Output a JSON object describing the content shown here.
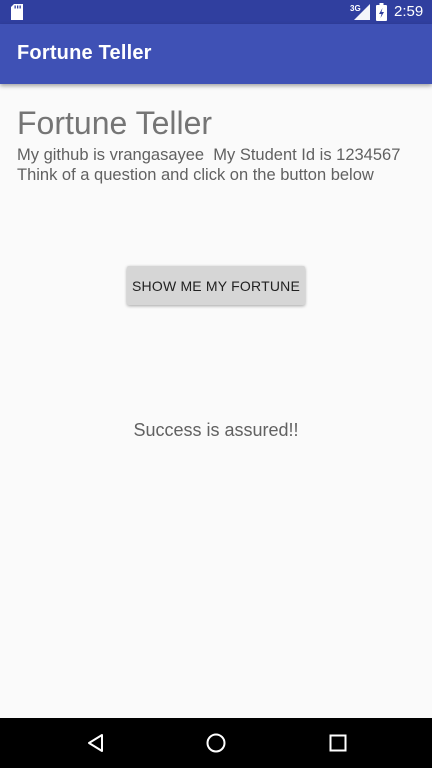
{
  "status_bar": {
    "network_label": "3G",
    "time": "2:59",
    "icons": [
      "sd-card-icon",
      "signal-icon",
      "battery-icon"
    ]
  },
  "app_bar": {
    "title": "Fortune Teller"
  },
  "main": {
    "heading": "Fortune Teller",
    "info_line_1": "My github is vrangasayee  My Student Id is 1234567",
    "info_line_2": "Think of a question and click on the button below",
    "button_label": "SHOW ME MY FORTUNE",
    "fortune": "Success is assured!!"
  },
  "nav_bar": {
    "icons": [
      "back-icon",
      "home-icon",
      "recent-apps-icon"
    ]
  },
  "colors": {
    "status_bar": "#303f9f",
    "app_bar": "#3f51b5",
    "background": "#fafafa",
    "button": "#d6d6d6"
  }
}
